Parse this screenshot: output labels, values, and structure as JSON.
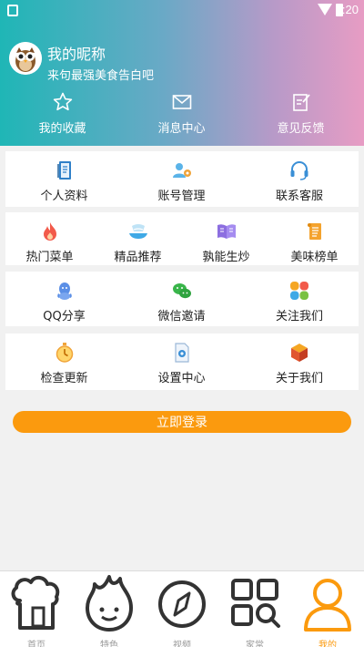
{
  "status": {
    "time": "9:20"
  },
  "profile": {
    "nickname": "我的昵称",
    "tagline": "来句最强美食告白吧"
  },
  "quick_actions": [
    {
      "label": "我的收藏",
      "icon": "star-icon"
    },
    {
      "label": "消息中心",
      "icon": "mail-icon"
    },
    {
      "label": "意见反馈",
      "icon": "edit-icon"
    }
  ],
  "cards": [
    [
      {
        "label": "个人资料",
        "icon": "profile-book-icon"
      },
      {
        "label": "账号管理",
        "icon": "account-manage-icon"
      },
      {
        "label": "联系客服",
        "icon": "headset-icon"
      }
    ],
    [
      {
        "label": "热门菜单",
        "icon": "flame-icon"
      },
      {
        "label": "精品推荐",
        "icon": "dish-icon"
      },
      {
        "label": "孰能生炒",
        "icon": "open-book-icon"
      },
      {
        "label": "美味榜单",
        "icon": "scroll-icon"
      }
    ],
    [
      {
        "label": "QQ分享",
        "icon": "qq-icon"
      },
      {
        "label": "微信邀请",
        "icon": "wechat-icon"
      },
      {
        "label": "关注我们",
        "icon": "clover-icon"
      }
    ],
    [
      {
        "label": "检查更新",
        "icon": "stopwatch-icon"
      },
      {
        "label": "设置中心",
        "icon": "settings-doc-icon"
      },
      {
        "label": "关于我们",
        "icon": "cube-icon"
      }
    ]
  ],
  "login_button": "立即登录",
  "tabs": [
    {
      "label": "首页",
      "icon": "home-chef-icon",
      "active": false
    },
    {
      "label": "特色",
      "icon": "flame-face-icon",
      "active": false
    },
    {
      "label": "视频",
      "icon": "compass-icon",
      "active": false
    },
    {
      "label": "家常",
      "icon": "grid-search-icon",
      "active": false
    },
    {
      "label": "我的",
      "icon": "person-icon",
      "active": true
    }
  ],
  "colors": {
    "accent": "#fb9a0e",
    "header_start": "#1fb6b6",
    "header_end": "#e79cc4"
  }
}
